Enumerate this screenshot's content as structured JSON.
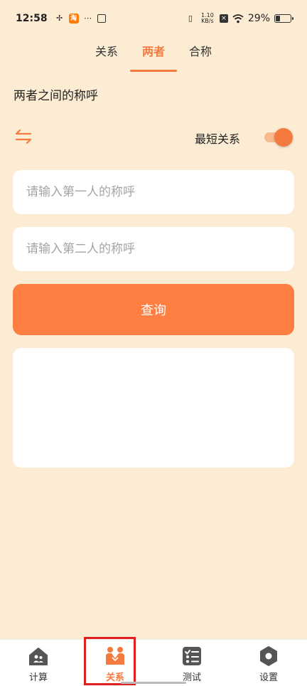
{
  "status_bar": {
    "time": "12:58",
    "taobao": "淘",
    "net_speed_value": "1.10",
    "net_speed_unit": "KB/s",
    "battery": "29%"
  },
  "tabs": [
    {
      "label": "关系",
      "active": false
    },
    {
      "label": "两者",
      "active": true
    },
    {
      "label": "合称",
      "active": false
    }
  ],
  "page_title": "两者之间的称呼",
  "shortest_label": "最短关系",
  "shortest_enabled": true,
  "input1": {
    "value": "",
    "placeholder": "请输入第一人的称呼"
  },
  "input2": {
    "value": "",
    "placeholder": "请输入第二人的称呼"
  },
  "query_label": "查询",
  "result_text": "",
  "bottom_nav": [
    {
      "label": "计算",
      "icon": "home-people-icon",
      "active": false
    },
    {
      "label": "关系",
      "icon": "handshake-people-icon",
      "active": true
    },
    {
      "label": "测试",
      "icon": "checklist-icon",
      "active": false
    },
    {
      "label": "设置",
      "icon": "hexagon-gear-icon",
      "active": false
    }
  ],
  "colors": {
    "accent": "#f47a3f",
    "button": "#ff7e41",
    "background": "#fcecd4",
    "highlight": "#e02020"
  }
}
